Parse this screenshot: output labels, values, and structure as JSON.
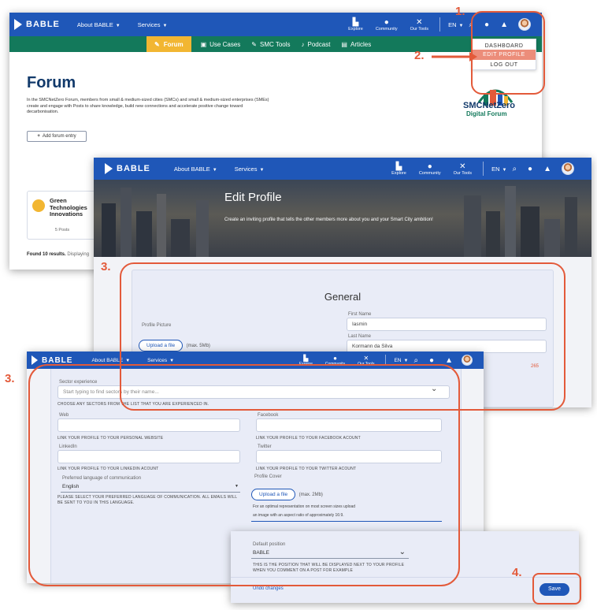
{
  "steps": [
    "1.",
    "2.",
    "3.",
    "3.",
    "4."
  ],
  "nav": {
    "logo": "BABLE",
    "about": "About BABLE",
    "services": "Services",
    "explore": "Explore",
    "community": "Community",
    "tools": "Our Tools",
    "lang": "EN"
  },
  "forum_page": {
    "tabs": [
      "Forum",
      "Use Cases",
      "SMC Tools",
      "Podcast",
      "Articles"
    ],
    "title": "Forum",
    "description": "In the SMCNetZero Forum, members from small & medium-sized cities (SMCs) and small & medium-sized enterprises (SMEs) create and engage with Posts to share knowledge, build new connections and accelerate positive change toward decarbonisation.",
    "add_button": "Add forum entry",
    "brand_line1": "SMCNetZero",
    "brand_line2": "Digital Forum",
    "card_title": "Green Technologies Innovations",
    "card_posts": "5 Posts",
    "results_bold": "Found 10 results.",
    "results_rest": "Displaying",
    "dropdown": [
      "DASHBOARD",
      "EDIT PROFILE",
      "LOG OUT"
    ]
  },
  "edit_profile": {
    "title": "Edit Profile",
    "subtitle": "Create an inviting profile that tells the other members more about you and your Smart City ambition!",
    "section": "General",
    "first_name_label": "First Name",
    "first_name_value": "Iasmin",
    "last_name_label": "Last Name",
    "last_name_value": "Kormann da Silva",
    "profile_picture_label": "Profile Picture",
    "upload_label": "Upload a file",
    "upload_max": "(max. 5Mb)",
    "char_count": "265"
  },
  "profile_form": {
    "sector_label": "Sector experience",
    "sector_placeholder": "Start typing to find sectors by their name...",
    "sector_hint": "CHOOSE ANY SECTORS FROM THE LIST THAT YOU ARE EXPERIENCED IN.",
    "web_label": "Web",
    "web_hint": "LINK YOUR PROFILE TO YOUR PERSONAL WEBSITE",
    "facebook_label": "Facebook",
    "facebook_hint": "LINK YOUR PROFILE TO YOUR FACEBOOK ACOUNT",
    "linkedin_label": "LinkedIn",
    "linkedin_hint": "LINK YOUR PROFILE TO YOUR LINKEDIN ACOUNT",
    "twitter_label": "Twitter",
    "twitter_hint": "LINK YOUR PROFILE TO YOUR TWITTER ACOUNT",
    "language_label": "Preferred language of communication",
    "language_value": "English",
    "language_hint": "PLEASE SELECT YOUR PREFERRED LANGUAGE OF COMMUNICATION. ALL EMAILS WILL BE SENT TO YOU IN THIS LANGUAGE.",
    "cover_label": "Profile Cover",
    "cover_upload": "Upload a file",
    "cover_max": "(max. 2Mb)",
    "cover_hint1": "For an optimal representation on most screen sizes upload",
    "cover_hint2": "an image with an aspect ratio of approximately 16:9."
  },
  "save_panel": {
    "position_label": "Default position",
    "position_value": "BABLE",
    "position_hint": "THIS IS THE POSITION THAT WILL BE DISPLAYED NEXT TO YOUR PROFILE WHEN YOU COMMENT ON A POST FOR EXAMPLE",
    "undo": "Undo changes",
    "save": "Save"
  },
  "colors": {
    "brand_blue": "#1f57b8",
    "forum_green": "#13795b",
    "highlight": "#e35a3a",
    "active_tab": "#f2b632"
  }
}
